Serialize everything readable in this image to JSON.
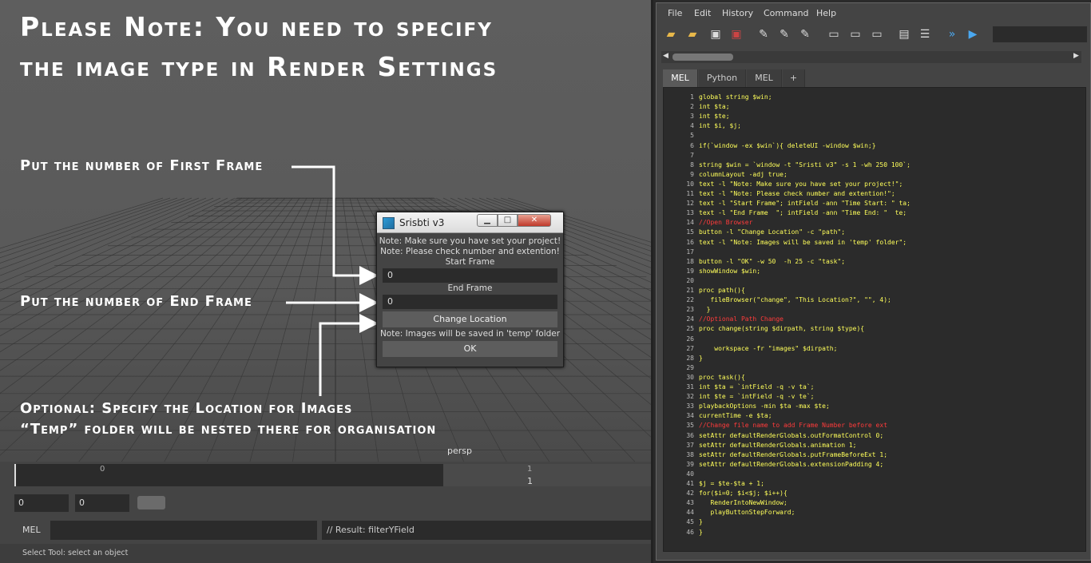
{
  "annotations": {
    "headline1": "Please Note: You need to specify",
    "headline2": "the image type in Render Settings",
    "first_frame": "Put the number of First Frame",
    "end_frame": "Put the number of End Frame",
    "optional1": "Optional: Specify the Location for Images",
    "optional2": "“Temp” folder will be nested there for organisation"
  },
  "viewport": {
    "camera_label": "persp"
  },
  "dialog": {
    "title": "Srisbti v3",
    "note1": "Note: Make sure you have set your project!",
    "note2": "Note: Please check number and extention!",
    "start_label": "Start Frame",
    "start_value": "0",
    "end_label": "End Frame",
    "end_value": "0",
    "location_button": "Change Location",
    "note3": "Note: Images will be saved in 'temp' folder",
    "ok_button": "OK",
    "min_glyph": "▁",
    "max_glyph": "□",
    "close_glyph": "✕"
  },
  "timeline": {
    "tick_start": "0",
    "tick_end": "1",
    "current_frame": "1"
  },
  "range": {
    "start": "0",
    "end": "0"
  },
  "command_line": {
    "label": "MEL",
    "result": "// Result: filterYField"
  },
  "help_line": "Select Tool: select an object",
  "script_editor": {
    "menus": [
      "File",
      "Edit",
      "History",
      "Command",
      "Help"
    ],
    "tabs": [
      "MEL",
      "Python",
      "MEL",
      "+"
    ],
    "code_lines": [
      {
        "n": "1",
        "t": "global string $win;"
      },
      {
        "n": "2",
        "t": "int $ta;"
      },
      {
        "n": "3",
        "t": "int $te;"
      },
      {
        "n": "4",
        "t": "int $i, $j;"
      },
      {
        "n": "5",
        "t": ""
      },
      {
        "n": "6",
        "t": "if(`window -ex $win`){ deleteUI -window $win;}"
      },
      {
        "n": "7",
        "t": ""
      },
      {
        "n": "8",
        "t": "string $win = `window -t \"Sristi v3\" -s 1 -wh 250 100`;"
      },
      {
        "n": "9",
        "t": "columnLayout -adj true;"
      },
      {
        "n": "10",
        "t": "text -l \"Note: Make sure you have set your project!\";"
      },
      {
        "n": "11",
        "t": "text -l \"Note: Please check number and extention!\";"
      },
      {
        "n": "12",
        "t": "text -l \"Start Frame\"; intField -ann \"Time Start: \" ta;"
      },
      {
        "n": "13",
        "t": "text -l \"End Frame  \"; intField -ann \"Time End: \"  te;"
      },
      {
        "n": "14",
        "t": "//Open Browser",
        "c": true
      },
      {
        "n": "15",
        "t": "button -l \"Change Location\" -c \"path\";"
      },
      {
        "n": "16",
        "t": "text -l \"Note: Images will be saved in 'temp' folder\";"
      },
      {
        "n": "17",
        "t": ""
      },
      {
        "n": "18",
        "t": "button -l \"OK\" -w 50  -h 25 -c \"task\";"
      },
      {
        "n": "19",
        "t": "showWindow $win;"
      },
      {
        "n": "20",
        "t": ""
      },
      {
        "n": "21",
        "t": "proc path(){"
      },
      {
        "n": "22",
        "t": "   fileBrowser(\"change\", \"This Location?\", \"\", 4);"
      },
      {
        "n": "23",
        "t": "  }"
      },
      {
        "n": "24",
        "t": "//Optional Path Change",
        "c": true
      },
      {
        "n": "25",
        "t": "proc change(string $dirpath, string $type){"
      },
      {
        "n": "26",
        "t": ""
      },
      {
        "n": "27",
        "t": "    workspace -fr \"images\" $dirpath;"
      },
      {
        "n": "28",
        "t": "}"
      },
      {
        "n": "29",
        "t": ""
      },
      {
        "n": "30",
        "t": "proc task(){"
      },
      {
        "n": "31",
        "t": "int $ta = `intField -q -v ta`;"
      },
      {
        "n": "32",
        "t": "int $te = `intField -q -v te`;"
      },
      {
        "n": "33",
        "t": "playbackOptions -min $ta -max $te;"
      },
      {
        "n": "34",
        "t": "currentTime -e $ta;"
      },
      {
        "n": "35",
        "t": "//Change file name to add Frame Number before ext",
        "c": true
      },
      {
        "n": "36",
        "t": "setAttr defaultRenderGlobals.outFormatControl 0;"
      },
      {
        "n": "37",
        "t": "setAttr defaultRenderGlobals.animation 1;"
      },
      {
        "n": "38",
        "t": "setAttr defaultRenderGlobals.putFrameBeforeExt 1;"
      },
      {
        "n": "39",
        "t": "setAttr defaultRenderGlobals.extensionPadding 4;"
      },
      {
        "n": "40",
        "t": ""
      },
      {
        "n": "41",
        "t": "$j = $te-$ta + 1;"
      },
      {
        "n": "42",
        "t": "for($i=0; $i<$j; $i++){"
      },
      {
        "n": "43",
        "t": "   RenderIntoNewWindow;"
      },
      {
        "n": "44",
        "t": "   playButtonStepForward;"
      },
      {
        "n": "45",
        "t": "}"
      },
      {
        "n": "46",
        "t": "}"
      }
    ]
  }
}
